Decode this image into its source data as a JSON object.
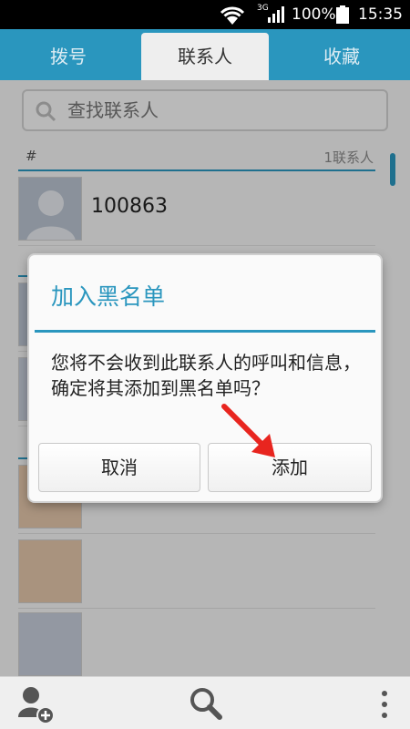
{
  "status_bar": {
    "network": "3G",
    "battery": "100%",
    "time": "15:35"
  },
  "tabs": [
    {
      "label": "拨号"
    },
    {
      "label": "联系人"
    },
    {
      "label": "收藏"
    }
  ],
  "search": {
    "placeholder": "查找联系人"
  },
  "list_header": {
    "index_char": "#",
    "count": "1联系人"
  },
  "contacts": [
    {
      "name": "100863"
    }
  ],
  "dialog": {
    "title": "加入黑名单",
    "message": "您将不会收到此联系人的呼叫和信息，确定将其添加到黑名单吗？",
    "cancel_label": "取消",
    "add_label": "添加"
  },
  "colors": {
    "accent": "#2a96be",
    "arrow": "#e8251f"
  },
  "bottom_bar": {
    "icons": [
      "add-contact-icon",
      "search-icon",
      "more-icon"
    ]
  }
}
